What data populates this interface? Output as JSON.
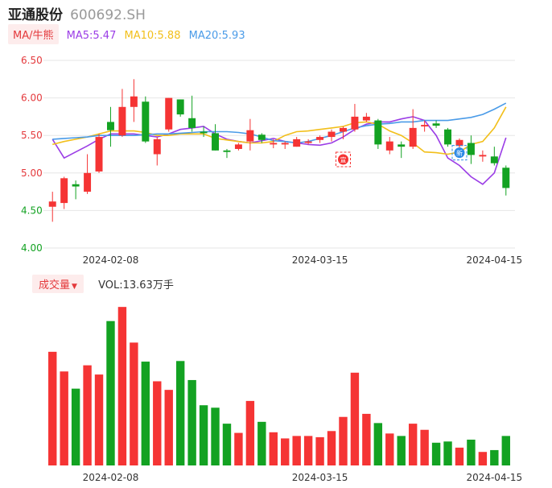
{
  "header": {
    "stock_name": "亚通股份",
    "stock_code": "600692.SH"
  },
  "ma_legend": {
    "toggle_label": "MA/牛熊",
    "items": [
      {
        "label": "MA5:5.47",
        "color": "#9b3de6"
      },
      {
        "label": "MA10:5.88",
        "color": "#f2bf1a"
      },
      {
        "label": "MA20:5.93",
        "color": "#4a9be8"
      }
    ]
  },
  "volume_legend": {
    "toggle_label": "成交量",
    "caret": "▼",
    "value_label": "VOL:13.63万手"
  },
  "colors": {
    "up": "#f53434",
    "down": "#13a222",
    "grid": "#e6e6e6",
    "axis_red": "#e4393c",
    "axis_green": "#13a222",
    "date_text": "#333333"
  },
  "chart_data": [
    {
      "type": "candlestick",
      "ylim": [
        4.0,
        6.5
      ],
      "yticks": [
        "6.50",
        "6.00",
        "5.50",
        "5.00",
        "4.50",
        "4.00"
      ],
      "xticks": [
        {
          "index": 5,
          "label": "2024-02-08"
        },
        {
          "index": 23,
          "label": "2024-03-15"
        },
        {
          "index": 38,
          "label": "2024-04-15"
        }
      ],
      "candles": [
        {
          "o": 4.55,
          "c": 4.62,
          "h": 4.75,
          "l": 4.35
        },
        {
          "o": 4.6,
          "c": 4.93,
          "h": 4.95,
          "l": 4.52
        },
        {
          "o": 4.85,
          "c": 4.82,
          "h": 4.9,
          "l": 4.65
        },
        {
          "o": 4.75,
          "c": 5.0,
          "h": 5.25,
          "l": 4.72
        },
        {
          "o": 5.02,
          "c": 5.48,
          "h": 5.52,
          "l": 5.0
        },
        {
          "o": 5.68,
          "c": 5.57,
          "h": 5.88,
          "l": 5.35
        },
        {
          "o": 5.5,
          "c": 5.88,
          "h": 6.12,
          "l": 5.48
        },
        {
          "o": 5.88,
          "c": 6.02,
          "h": 6.25,
          "l": 5.68
        },
        {
          "o": 5.95,
          "c": 5.42,
          "h": 6.02,
          "l": 5.4
        },
        {
          "o": 5.25,
          "c": 5.45,
          "h": 5.48,
          "l": 5.1
        },
        {
          "o": 5.58,
          "c": 6.0,
          "h": 6.0,
          "l": 5.55
        },
        {
          "o": 5.98,
          "c": 5.78,
          "h": 5.98,
          "l": 5.75
        },
        {
          "o": 5.73,
          "c": 5.6,
          "h": 6.03,
          "l": 5.55
        },
        {
          "o": 5.55,
          "c": 5.53,
          "h": 5.62,
          "l": 5.48
        },
        {
          "o": 5.53,
          "c": 5.3,
          "h": 5.65,
          "l": 5.3
        },
        {
          "o": 5.3,
          "c": 5.28,
          "h": 5.32,
          "l": 5.2
        },
        {
          "o": 5.32,
          "c": 5.38,
          "h": 5.4,
          "l": 5.3
        },
        {
          "o": 5.42,
          "c": 5.57,
          "h": 5.72,
          "l": 5.3
        },
        {
          "o": 5.51,
          "c": 5.44,
          "h": 5.53,
          "l": 5.4
        },
        {
          "o": 5.38,
          "c": 5.4,
          "h": 5.45,
          "l": 5.33
        },
        {
          "o": 5.38,
          "c": 5.4,
          "h": 5.42,
          "l": 5.32
        },
        {
          "o": 5.35,
          "c": 5.45,
          "h": 5.48,
          "l": 5.35
        },
        {
          "o": 5.4,
          "c": 5.42,
          "h": 5.45,
          "l": 5.38
        },
        {
          "o": 5.44,
          "c": 5.48,
          "h": 5.5,
          "l": 5.4
        },
        {
          "o": 5.48,
          "c": 5.55,
          "h": 5.58,
          "l": 5.42
        },
        {
          "o": 5.55,
          "c": 5.6,
          "h": 5.62,
          "l": 5.45
        },
        {
          "o": 5.58,
          "c": 5.75,
          "h": 5.92,
          "l": 5.55
        },
        {
          "o": 5.7,
          "c": 5.75,
          "h": 5.8,
          "l": 5.68
        },
        {
          "o": 5.7,
          "c": 5.38,
          "h": 5.72,
          "l": 5.32
        },
        {
          "o": 5.3,
          "c": 5.42,
          "h": 5.48,
          "l": 5.25
        },
        {
          "o": 5.38,
          "c": 5.35,
          "h": 5.42,
          "l": 5.2
        },
        {
          "o": 5.35,
          "c": 5.6,
          "h": 5.85,
          "l": 5.32
        },
        {
          "o": 5.62,
          "c": 5.64,
          "h": 5.7,
          "l": 5.55
        },
        {
          "o": 5.66,
          "c": 5.63,
          "h": 5.7,
          "l": 5.6
        },
        {
          "o": 5.58,
          "c": 5.38,
          "h": 5.6,
          "l": 5.35
        },
        {
          "o": 5.36,
          "c": 5.44,
          "h": 5.46,
          "l": 5.32
        },
        {
          "o": 5.4,
          "c": 5.24,
          "h": 5.5,
          "l": 5.12
        },
        {
          "o": 5.22,
          "c": 5.24,
          "h": 5.3,
          "l": 5.15
        },
        {
          "o": 5.22,
          "c": 5.13,
          "h": 5.35,
          "l": 5.1
        },
        {
          "o": 5.07,
          "c": 4.8,
          "h": 5.1,
          "l": 4.7
        }
      ],
      "ma": {
        "ma5": [
          5.45,
          5.2,
          5.28,
          5.36,
          5.45,
          5.52,
          5.52,
          5.52,
          5.5,
          5.48,
          5.52,
          5.58,
          5.6,
          5.62,
          5.52,
          5.45,
          5.42,
          5.4,
          5.43,
          5.46,
          5.42,
          5.4,
          5.38,
          5.37,
          5.4,
          5.48,
          5.58,
          5.65,
          5.68,
          5.68,
          5.72,
          5.75,
          5.7,
          5.5,
          5.2,
          5.1,
          4.95,
          4.85,
          5.0,
          5.47
        ],
        "ma10": [
          5.38,
          5.42,
          5.45,
          5.48,
          5.52,
          5.56,
          5.56,
          5.56,
          5.54,
          5.5,
          5.5,
          5.52,
          5.52,
          5.52,
          5.46,
          5.44,
          5.42,
          5.4,
          5.4,
          5.42,
          5.5,
          5.55,
          5.56,
          5.58,
          5.6,
          5.62,
          5.67,
          5.68,
          5.65,
          5.56,
          5.5,
          5.4,
          5.28,
          5.27,
          5.25,
          5.28,
          5.38,
          5.42,
          5.6,
          5.88
        ],
        "ma20": [
          5.45,
          5.46,
          5.47,
          5.48,
          5.5,
          5.5,
          5.5,
          5.5,
          5.51,
          5.52,
          5.52,
          5.53,
          5.54,
          5.55,
          5.55,
          5.55,
          5.54,
          5.52,
          5.48,
          5.43,
          5.42,
          5.4,
          5.42,
          5.46,
          5.5,
          5.55,
          5.6,
          5.63,
          5.65,
          5.66,
          5.68,
          5.68,
          5.7,
          5.7,
          5.7,
          5.72,
          5.74,
          5.78,
          5.85,
          5.93
        ]
      },
      "markers": [
        {
          "index": 25,
          "price": 5.18,
          "label": "宣",
          "color": "#f53434"
        },
        {
          "index": 35,
          "price": 5.27,
          "label": "新",
          "color": "#2e8ae6"
        }
      ]
    },
    {
      "type": "bar",
      "title": "成交量",
      "value_label": "VOL:13.63万手",
      "xticks": [
        {
          "index": 5,
          "label": "2024-02-08"
        },
        {
          "index": 23,
          "label": "2024-03-15"
        },
        {
          "index": 38,
          "label": "2024-04-15"
        }
      ],
      "volumes": [
        18.5,
        15.3,
        12.5,
        16.3,
        14.8,
        23.5,
        25.8,
        20.0,
        16.9,
        13.7,
        12.3,
        17.0,
        13.9,
        9.8,
        9.4,
        6.8,
        5.3,
        10.5,
        7.1,
        5.4,
        4.4,
        4.8,
        4.8,
        4.6,
        5.6,
        7.9,
        15.1,
        8.4,
        6.9,
        5.2,
        4.8,
        6.8,
        5.8,
        3.7,
        3.9,
        2.9,
        4.2,
        2.2,
        2.5,
        4.8
      ],
      "ylim": [
        0,
        27
      ]
    }
  ]
}
